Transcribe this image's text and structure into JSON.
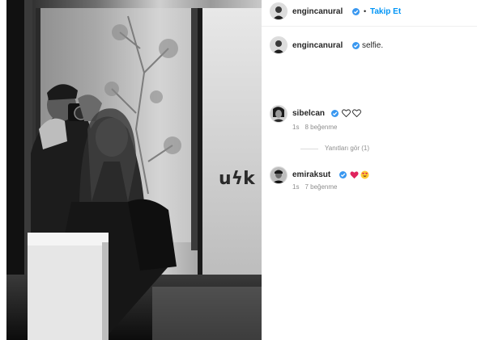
{
  "post": {
    "author": "engincanural",
    "follow_label": "Takip Et",
    "separator": "•",
    "caption": "selfie."
  },
  "comments": [
    {
      "username": "sibelcan",
      "text_icons": [
        "white-heart",
        "white-heart"
      ],
      "time": "1s",
      "likes": "8 beğenme",
      "replies": "Yanıtları gör (1)"
    },
    {
      "username": "emiraksut",
      "text_icons": [
        "red-heart",
        "heart-eyes"
      ],
      "time": "1s",
      "likes": "7 beğenme"
    }
  ],
  "colors": {
    "link_blue": "#0095f6",
    "verified_blue": "#3897f0",
    "muted_text": "#8e8e8e"
  }
}
